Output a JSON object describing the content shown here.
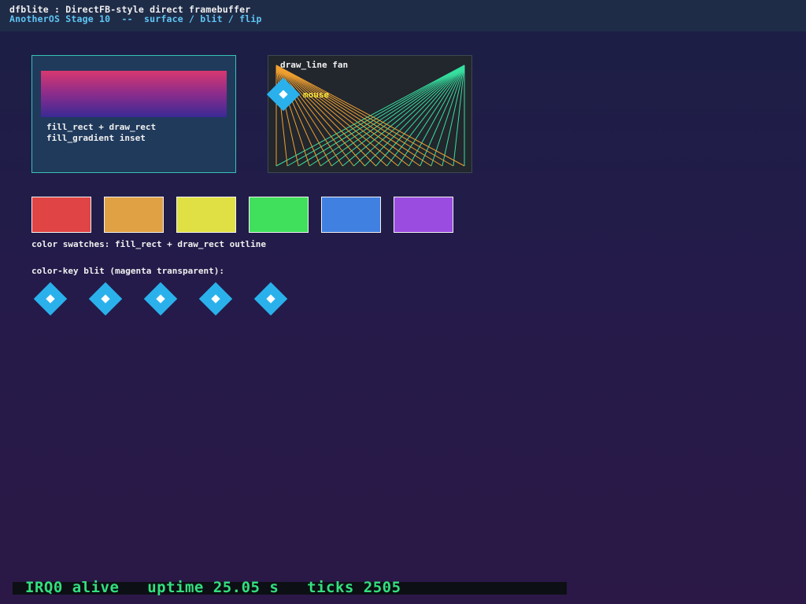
{
  "title": {
    "line1": "dfblite : DirectFB-style direct framebuffer",
    "line2": "AnotherOS Stage 10  --  surface / blit / flip"
  },
  "panel_rect": {
    "caption_line1": "fill_rect + draw_rect",
    "caption_line2": "fill_gradient inset"
  },
  "panel_fan": {
    "title": "draw_line fan",
    "mouse_label": "mouse"
  },
  "swatches": {
    "colors": [
      "#e04444",
      "#e0a044",
      "#e0e044",
      "#40e05c",
      "#4080e0",
      "#9a4ce0"
    ],
    "label": "color swatches: fill_rect + draw_rect outline"
  },
  "colorkey": {
    "label": "color-key blit (magenta transparent):",
    "count": 5
  },
  "status": {
    "text": "IRQ0 alive   uptime 25.05 s   ticks 2505"
  },
  "colors": {
    "accent_cyan": "#2ab1ec",
    "fan_left": "#36e0a0",
    "fan_right": "#f0a030",
    "status_green": "#33e07f"
  }
}
